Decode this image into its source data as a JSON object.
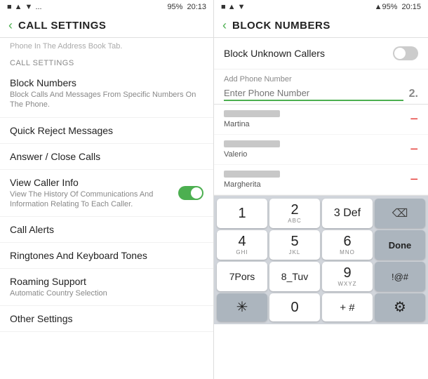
{
  "left": {
    "statusBar": {
      "icons": "■ ▲ ▼ ...",
      "battery": "95%",
      "time": "20:13"
    },
    "backLabel": "‹",
    "title": "CALL SETTINGS",
    "topNote": "Phone In The Address Book Tab.",
    "sectionHeader": "CALL SETTINGS",
    "menuItems": [
      {
        "title": "Block Numbers",
        "subtitle": "Block Calls And Messages From Specific Numbers On The Phone."
      },
      {
        "title": "Quick Reject Messages",
        "subtitle": ""
      },
      {
        "title": "Answer / Close Calls",
        "subtitle": ""
      }
    ],
    "toggleItem": {
      "title": "View Caller Info",
      "subtitle": "View The History Of Communications And Information Relating To Each Caller.",
      "enabled": true
    },
    "bottomItems": [
      {
        "title": "Call Alerts",
        "subtitle": ""
      },
      {
        "title": "Ringtones And Keyboard Tones",
        "subtitle": ""
      },
      {
        "title": "Roaming Support",
        "subtitle": "Automatic Country Selection"
      },
      {
        "title": "Other Settings",
        "subtitle": ""
      }
    ]
  },
  "right": {
    "statusBar": {
      "icons": "■ ▲ ▼",
      "signal": "▲95%",
      "time": "20:15"
    },
    "backLabel": "‹",
    "title": "BLOCK NUMBERS",
    "blockUnknown": {
      "label": "Block Unknown Callers",
      "enabled": false
    },
    "addPhone": {
      "label": "Add Phone Number",
      "placeholder": "Enter Phone Number",
      "numLabel": "2."
    },
    "contacts": [
      {
        "name": "Martina"
      },
      {
        "name": "Valerio"
      },
      {
        "name": "Margherita"
      }
    ],
    "keyboard": {
      "rows": [
        [
          {
            "main": "1",
            "sub": "",
            "type": "normal"
          },
          {
            "main": "2",
            "sub": "ABC",
            "type": "normal"
          },
          {
            "main": "3 Def",
            "sub": "",
            "type": "normal"
          },
          {
            "main": "⌫",
            "sub": "",
            "type": "dark",
            "name": "backspace"
          }
        ],
        [
          {
            "main": "4",
            "sub": "GHI",
            "type": "normal"
          },
          {
            "main": "5",
            "sub": "JKL",
            "type": "normal"
          },
          {
            "main": "6",
            "sub": "MNO",
            "type": "normal"
          },
          {
            "main": "Done",
            "sub": "",
            "type": "done"
          }
        ],
        [
          {
            "main": "7Pors",
            "sub": "",
            "type": "normal"
          },
          {
            "main": "8_Tuv",
            "sub": "",
            "type": "normal"
          },
          {
            "main": "9",
            "sub": "WXYZ",
            "type": "normal"
          },
          {
            "main": "!@#",
            "sub": "",
            "type": "dark"
          }
        ],
        [
          {
            "main": "✳",
            "sub": "",
            "type": "dark"
          },
          {
            "main": "0",
            "sub": "",
            "type": "normal"
          },
          {
            "main": "+ #",
            "sub": "",
            "type": "normal"
          },
          {
            "main": "⚙",
            "sub": "",
            "type": "dark"
          }
        ]
      ]
    }
  }
}
